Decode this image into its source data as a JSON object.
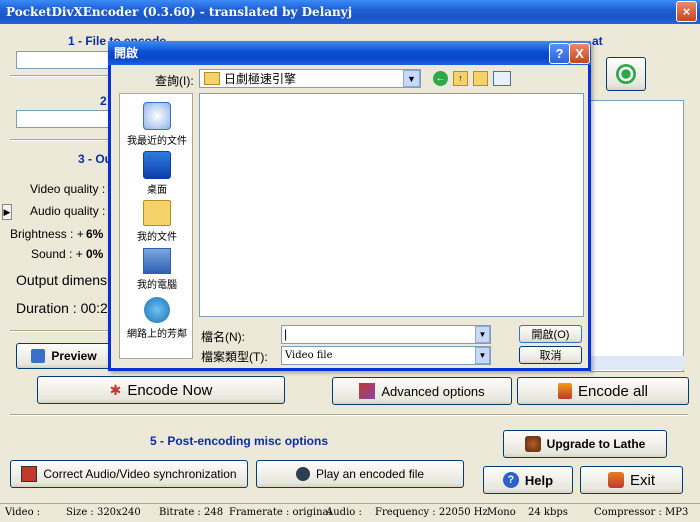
{
  "main_window": {
    "title": "PocketDivXEncoder (0.3.60) - translated by Delanyj",
    "section1_title": "1 - File to encode",
    "section2_title": "2",
    "section3_title": "3 - Ou",
    "section4_title": "4 - Encoding to format",
    "video_quality_label": "Video quality : 1",
    "audio_quality_label": "Audio quality :",
    "brightness_label": "Brightness : +",
    "brightness_value": "6%",
    "sound_label": "Sound : +",
    "sound_value": "0%",
    "output_dim_label": "Output dimensi",
    "duration_label": "Duration : 00:29",
    "preview_label": "Preview",
    "encode_now_label": "Encode Now",
    "advanced_options_label": "Advanced options",
    "encode_all_label": "Encode all",
    "section5_title": "5 - Post-encoding misc options",
    "correct_av_label": "Correct Audio/Video synchronization",
    "play_encoded_label": "Play an encoded file",
    "upgrade_label": "Upgrade to Lathe",
    "help_label": "Help",
    "exit_label": "Exit"
  },
  "status_bar": {
    "video": "Video :",
    "size": "Size : 320x240",
    "bitrate": "Bitrate : 248",
    "framerate": "Framerate : original",
    "audio": "Audio :",
    "frequency": "Frequency : 22050 Hz",
    "channels": "Mono",
    "kbps": "24 kbps",
    "compressor": "Compressor : MP3"
  },
  "dialog": {
    "title": "開啟",
    "help_btn": "?",
    "close_btn": "X",
    "lookin_label": "查詢(I):",
    "lookin_value": "日劇極速引擎",
    "places": [
      {
        "label": "我最近的文件"
      },
      {
        "label": "桌面"
      },
      {
        "label": "我的文件"
      },
      {
        "label": "我的電腦"
      },
      {
        "label": "網路上的芳鄰"
      }
    ],
    "filename_label": "檔名(N):",
    "filename_value": "",
    "filetype_label": "檔案類型(T):",
    "filetype_value": "Video file",
    "open_button": "開啟(O)",
    "cancel_button": "取消"
  },
  "colors": {
    "section_title": "#0b2ea8",
    "xp_title": "#1f5fd4",
    "window_bg": "#ece9d8"
  }
}
